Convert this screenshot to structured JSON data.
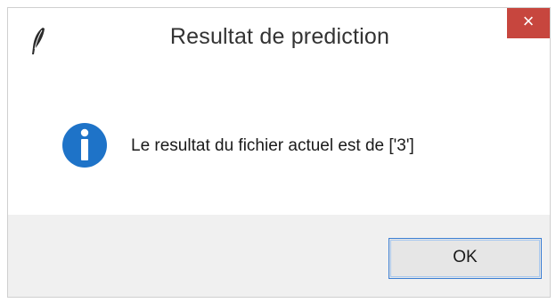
{
  "window": {
    "title": "Resultat de prediction",
    "close_glyph": "×",
    "app_icon": "feather-icon",
    "close_color": "#c7463e"
  },
  "message": {
    "icon": "info-icon",
    "icon_color": "#1e73c8",
    "text": "Le resultat du fichier actuel est de ['3']"
  },
  "buttons": {
    "ok_label": "OK",
    "ok_border_color": "#3c7fd4"
  }
}
